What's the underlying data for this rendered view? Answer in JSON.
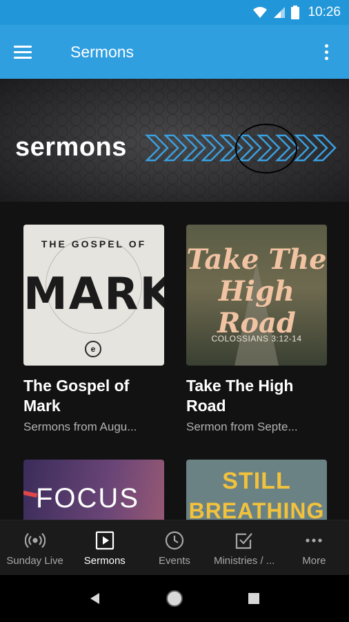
{
  "status_bar": {
    "time": "10:26"
  },
  "app_bar": {
    "title": "Sermons"
  },
  "banner": {
    "text": "sermons"
  },
  "cards": [
    {
      "art_pre": "THE GOSPEL OF",
      "art_main": "MARK",
      "title": "The Gospel of Mark",
      "subtitle": "Sermons from Augu..."
    },
    {
      "art_main": "Take The High Road",
      "art_sub": "COLOSSIANS 3:12-14",
      "title": "Take The High Road",
      "subtitle": "Sermon from Septe..."
    },
    {
      "art_main": "FOCUS"
    },
    {
      "art_line1": "STILL",
      "art_line2": "BREATHING"
    }
  ],
  "bottom_nav": {
    "items": [
      {
        "label": "Sunday Live",
        "icon": "broadcast-icon",
        "active": false
      },
      {
        "label": "Sermons",
        "icon": "play-square-icon",
        "active": true
      },
      {
        "label": "Events",
        "icon": "clock-icon",
        "active": false
      },
      {
        "label": "Ministries / ...",
        "icon": "checkbox-icon",
        "active": false
      },
      {
        "label": "More",
        "icon": "more-horizontal-icon",
        "active": false
      }
    ]
  },
  "colors": {
    "status_bar": "#2196d9",
    "app_bar": "#2f9fe0",
    "background": "#121212",
    "banner_chevron": "#3aa0e0"
  }
}
